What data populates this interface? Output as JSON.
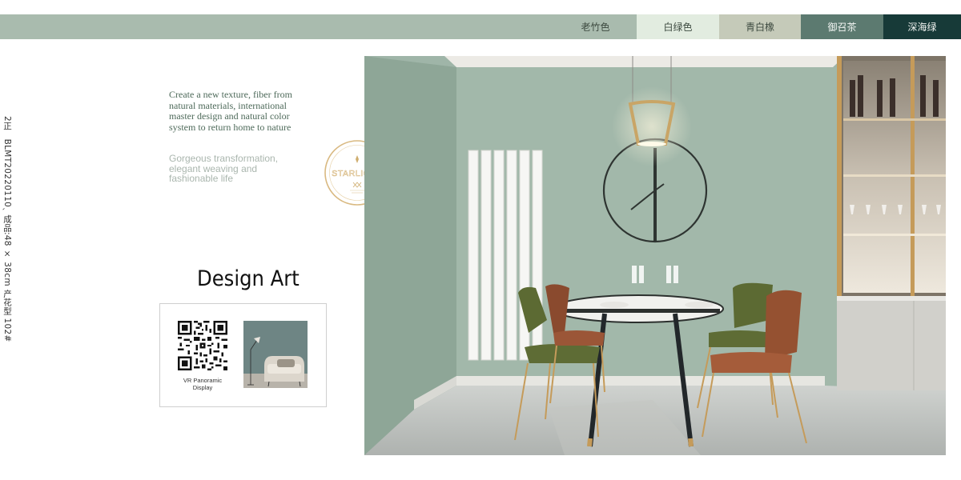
{
  "palette": {
    "swatches": [
      {
        "label": "老竹色",
        "color": "#a9bbae"
      },
      {
        "label": "白绿色",
        "color": "#e2ece0"
      },
      {
        "label": "青白橡",
        "color": "#c5cab9"
      },
      {
        "label": "御召茶",
        "color": "#5c7a70"
      },
      {
        "label": "深海绿",
        "color": "#173a38"
      }
    ]
  },
  "side_text": "2正　BLMT20220110ˎ 成品:48 × 38cm 产花型 102#",
  "copy": {
    "serif": "Create a new texture, fiber from natural materials, international master design and natural color system to return home to nature",
    "sans": "Gorgeous transformation, elegant weaving and fashionable life"
  },
  "title": "Design Art",
  "card": {
    "caption": "VR Panoramic Display"
  },
  "stamp": {
    "brand": "STARLIGHT"
  }
}
